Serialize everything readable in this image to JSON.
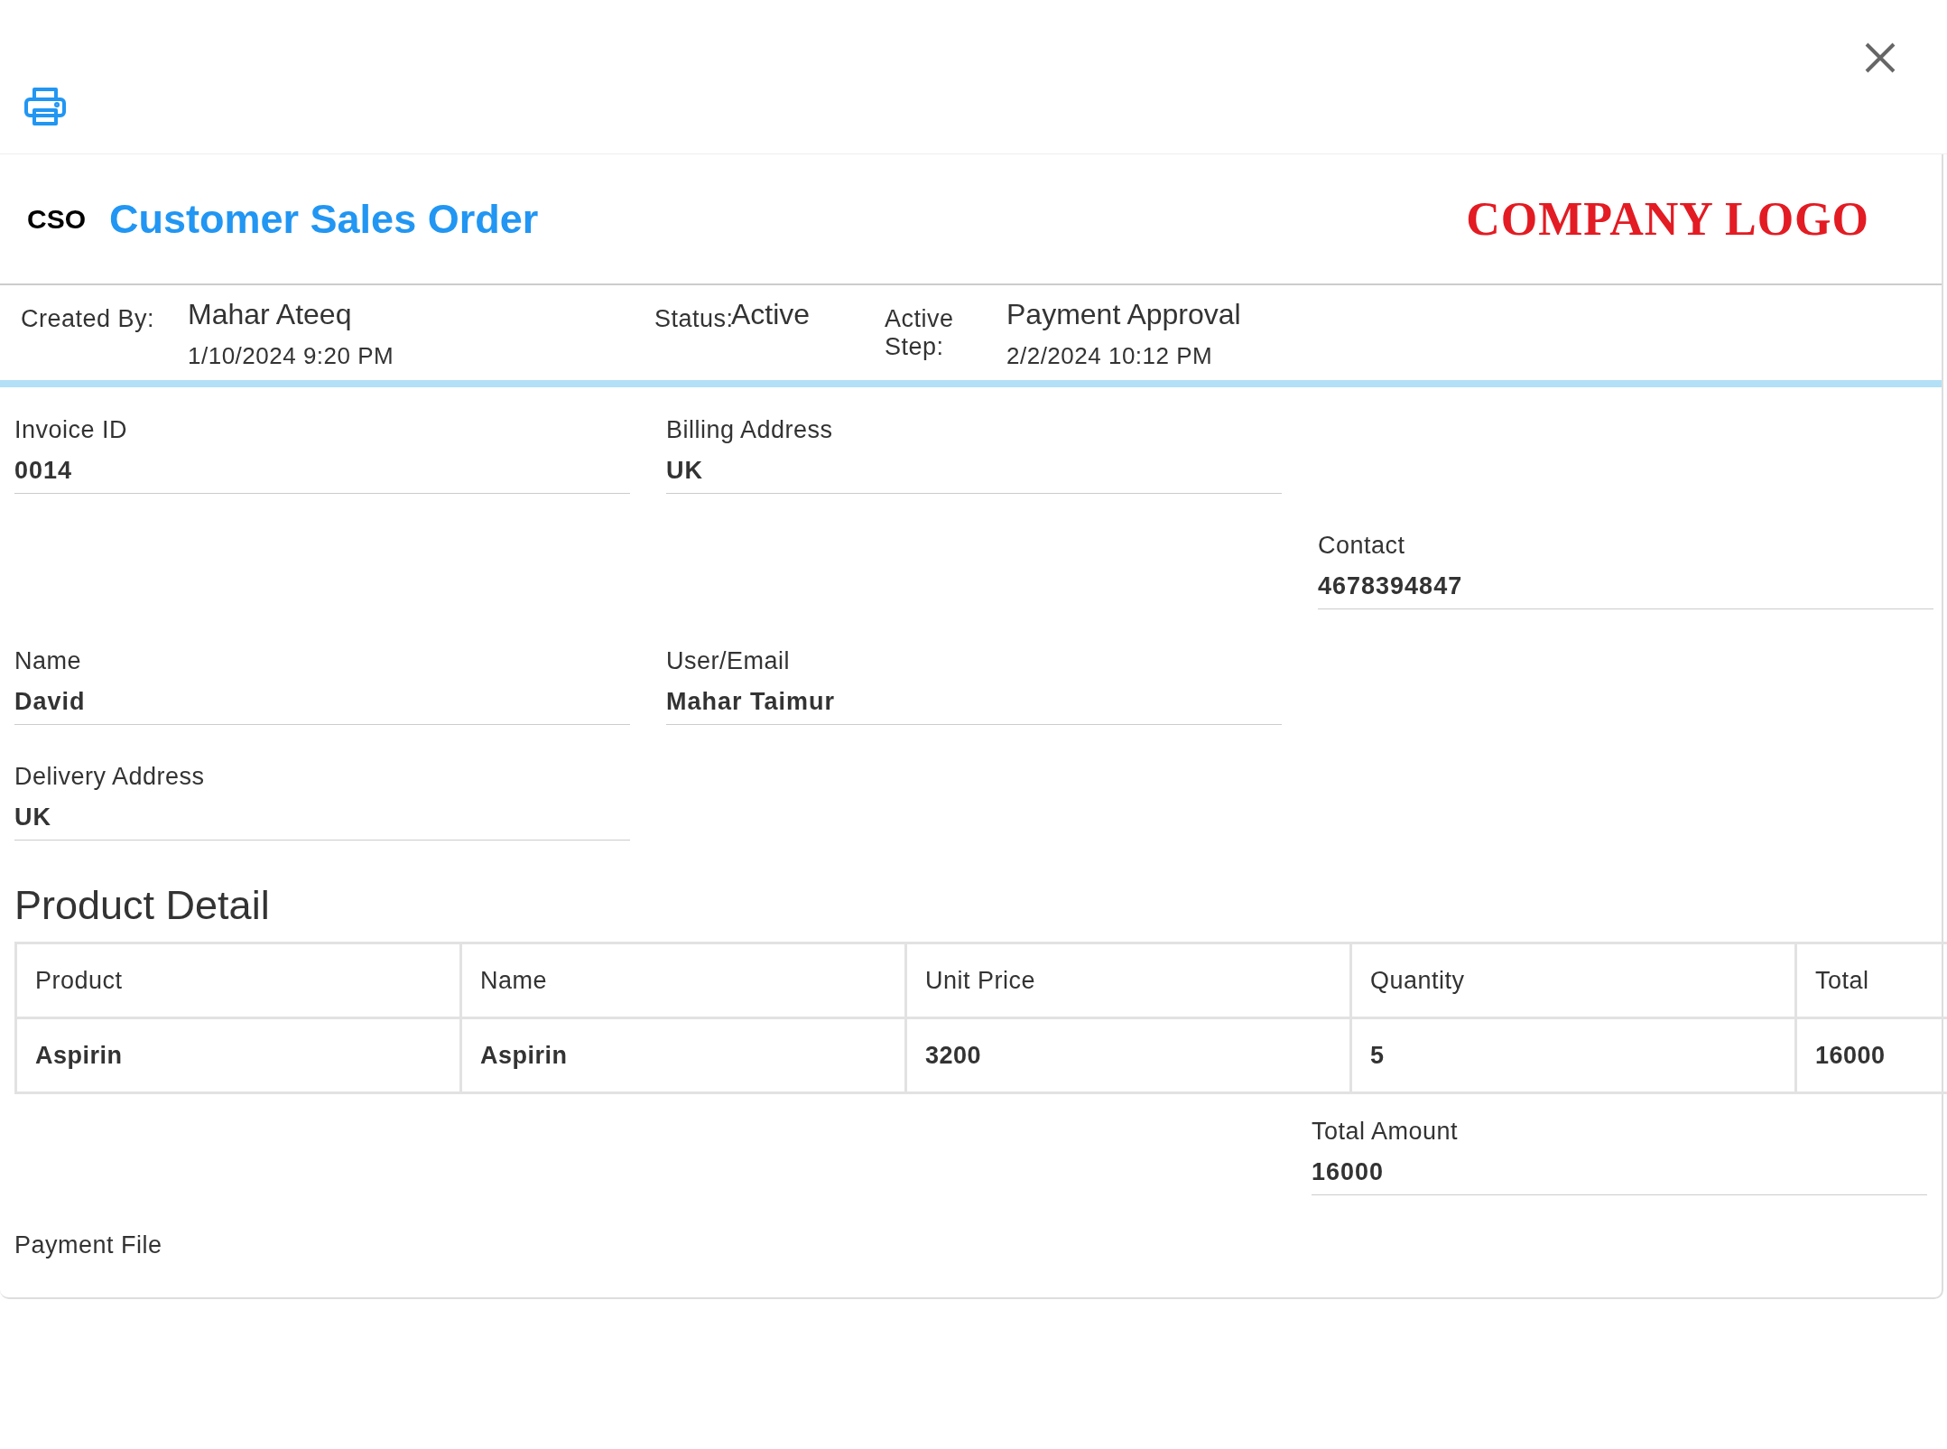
{
  "header": {
    "code": "CSO",
    "title": "Customer Sales Order",
    "logo": "COMPANY LOGO"
  },
  "meta": [
    {
      "label": "Created By:",
      "value": "Mahar Ateeq",
      "date": "1/10/2024 9:20 PM"
    },
    {
      "label": "Status:",
      "value": "Active"
    },
    {
      "label": "Active Step:",
      "value": "Payment Approval",
      "date": "2/2/2024 10:12 PM"
    }
  ],
  "fields": [
    {
      "label": "Invoice ID",
      "value": "0014"
    },
    {
      "label": "Billing Address",
      "value": "UK"
    },
    {
      "label": "Contact",
      "value": "4678394847"
    },
    {
      "label": "Name",
      "value": "David"
    },
    {
      "label": "User/Email",
      "value": "Mahar Taimur"
    },
    {
      "label": "Delivery Address",
      "value": "UK"
    }
  ],
  "product_detail": {
    "heading": "Product Detail",
    "columns": [
      "Product",
      "Name",
      "Unit Price",
      "Quantity",
      "Total"
    ],
    "rows": [
      [
        "Aspirin",
        "Aspirin",
        "3200",
        "5",
        "16000"
      ]
    ]
  },
  "total_amount": {
    "label": "Total Amount",
    "value": "16000"
  },
  "payment_file": {
    "label": "Payment File"
  }
}
